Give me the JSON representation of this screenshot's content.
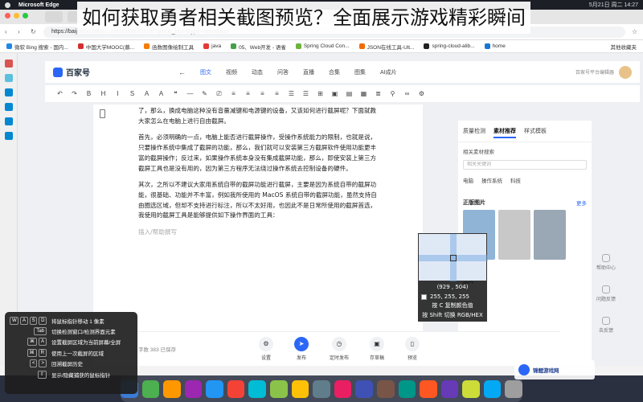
{
  "overlay_title": "如何获取勇者相关截图预览？全面展示游戏精彩瞬间",
  "menubar": {
    "app": "Microsoft Edge",
    "clock": "5月21日 周二 14:27"
  },
  "browser": {
    "url": "https://baijiahao.baidu.com/builder/rc/edit?article_ids=&type=news&wor",
    "bookmarks": [
      {
        "label": "微软 Bing 搜索 - 国内...",
        "color": "#1e88e5"
      },
      {
        "label": "中国大学MOOC(慕...",
        "color": "#d32f2f"
      },
      {
        "label": "函数图像绘制工具",
        "color": "#f57c00"
      },
      {
        "label": "java",
        "color": "#e53935"
      },
      {
        "label": "05、Web开发 - 语雀",
        "color": "#43a047"
      },
      {
        "label": "Spring Cloud Con...",
        "color": "#6db33f"
      },
      {
        "label": "JSON在线工具-Ult...",
        "color": "#ef6c00"
      },
      {
        "label": "spring-cloud-alib...",
        "color": "#222222"
      },
      {
        "label": "home",
        "color": "#1976d2"
      }
    ],
    "other_bookmarks": "其他收藏夹"
  },
  "site": {
    "logo": "百家号",
    "menu": [
      "图文",
      "视频",
      "动态",
      "问答",
      "直播",
      "合集",
      "图集",
      "AI成片"
    ],
    "active_menu": "图文",
    "header_right": "百家号平台编辑器"
  },
  "toolbar": [
    "↶",
    "↷",
    "B",
    "H",
    "I",
    "S",
    "A",
    "A",
    "❝",
    "—",
    "✎",
    "⎚",
    "≡",
    "≡",
    "≡",
    "≡",
    "☰",
    "☰",
    "⊞",
    "▣",
    "▤",
    "▦",
    "≣",
    "⚲",
    "∞",
    "⚙"
  ],
  "editor": {
    "paragraphs": [
      "了，那么，换成电脑这种没有音量减键和电源键的设备，又该如何进行截屏呢？下面就教大家怎么在电脑上进行自由截屏。",
      "首先，必须明确的一点，电脑上能否进行截屏操作，受操作系统能力的限制，也就是说，只要操作系统中集成了截屏的功能，那么，我们就可以安装第三方截屏软件使用功能更丰富的截屏操作；反过来，如果操作系统本身没有集成截屏功能，那么，即使安装上第三方截屏工具也是没有用的，因为第三方程序无法绕过操作系统去控制设备的硬件。",
      "其次，之所以不建议大家用系统自带的截屏功能进行截屏，主要是因为系统自带的截屏功能，很基础、功能并不丰富，例如我所使用的 MacOS 系统自带的截屏功能，虽然支持自由圈选区域，但却不支持进行标注，所以不太好用，也因此不是日常所使用的截屏首选，我使用的截屏工具是能够提供如下操作界面的工具："
    ],
    "placeholder": "插入/帮助撰写"
  },
  "right_panel": {
    "tabs": [
      "质量检测",
      "素材推荐",
      "样式模板"
    ],
    "active_tab": "素材推荐",
    "related_label": "相关素材搜索",
    "search_placeholder": "相关关键词",
    "tags": [
      "电脑",
      "操作系统",
      "科技"
    ],
    "copyright_section": "正版图片",
    "more": "更多",
    "gallery_section": "图片",
    "thumbs": [
      "#8fb4d6",
      "#c8c8c8",
      "#9aa7b5"
    ]
  },
  "float_icons": [
    "帮助中心",
    "问题反馈",
    "去反馈"
  ],
  "bottom": {
    "word_count": "字数 383  已保存",
    "actions": [
      {
        "label": "设置",
        "glyph": "⚙",
        "primary": false
      },
      {
        "label": "发布",
        "glyph": "➤",
        "primary": true
      },
      {
        "label": "定时发布",
        "glyph": "◷",
        "primary": false
      },
      {
        "label": "存草稿",
        "glyph": "▣",
        "primary": false
      },
      {
        "label": "预览",
        "glyph": "▯",
        "primary": false
      }
    ]
  },
  "magnifier": {
    "coords": "(929 , 504)",
    "rgb": "255, 255, 255",
    "hint1": "按 C 复制颜色值",
    "hint2": "按 Shift 切换 RGB/HEX"
  },
  "shortcuts": [
    {
      "keys": [
        "W",
        "A",
        "S",
        "D"
      ],
      "label": "将鼠标指针移动 1 像素"
    },
    {
      "keys": [
        "Tab"
      ],
      "label": "切换检测窗口/检测界面元素"
    },
    {
      "keys": [
        "⌘",
        "A"
      ],
      "label": "设置截屏区域为当前屏幕/全屏"
    },
    {
      "keys": [
        "⌘",
        "R"
      ],
      "label": "使用上一次截屏的区域"
    },
    {
      "keys": [
        "<",
        ">"
      ],
      "label": "回溯截屏历史"
    },
    {
      "keys": [
        "⇧"
      ],
      "label": "显示/隐藏捕获的鼠标指针"
    }
  ],
  "dock_colors": [
    "#3a7bd5",
    "#4caf50",
    "#ff9800",
    "#9c27b0",
    "#2196f3",
    "#f44336",
    "#00bcd4",
    "#8bc34a",
    "#ffc107",
    "#607d8b",
    "#e91e63",
    "#3f51b5",
    "#795548",
    "#009688",
    "#ff5722",
    "#673ab7",
    "#cddc39",
    "#03a9f4",
    "#9e9e9e"
  ],
  "watermark": "锦鲤游戏网"
}
